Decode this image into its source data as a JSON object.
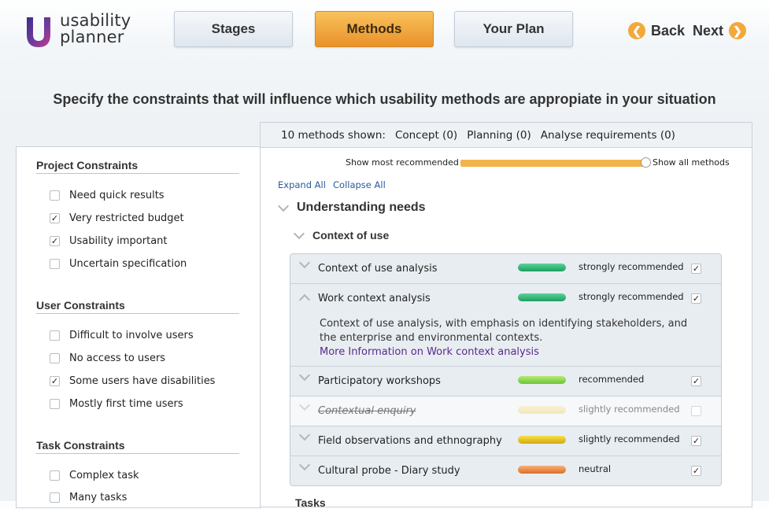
{
  "app": {
    "logo_line1": "usability",
    "logo_line2": "planner"
  },
  "nav": {
    "stages": "Stages",
    "methods": "Methods",
    "plan": "Your Plan",
    "back": "Back",
    "next": "Next",
    "active_color": "#f2a93b"
  },
  "heading": "Specify the constraints that will influence which usability methods are appropiate in your situation",
  "constraints": {
    "project": {
      "title": "Project Constraints",
      "items": [
        {
          "label": "Need quick results",
          "checked": false
        },
        {
          "label": "Very restricted budget",
          "checked": true
        },
        {
          "label": "Usability important",
          "checked": true
        },
        {
          "label": "Uncertain specification",
          "checked": false
        }
      ]
    },
    "user": {
      "title": "User Constraints",
      "items": [
        {
          "label": "Difficult to involve users",
          "checked": false
        },
        {
          "label": "No access to users",
          "checked": false
        },
        {
          "label": "Some users have disabilities",
          "checked": true
        },
        {
          "label": "Mostly first time users",
          "checked": false
        }
      ]
    },
    "task": {
      "title": "Task Constraints",
      "items": [
        {
          "label": "Complex task",
          "checked": false
        },
        {
          "label": "Many tasks",
          "checked": false
        }
      ]
    }
  },
  "summary": {
    "count": "10 methods shown:",
    "concept": "Concept (0)",
    "planning": "Planning (0)",
    "analyse": "Analyse requirements (0)"
  },
  "slider": {
    "left_label": "Show most recommended",
    "right_label": "Show all methods",
    "value": 1.0
  },
  "expand_all": "Expand All",
  "collapse_all": "Collapse All",
  "section": "Understanding needs",
  "subsection": "Context of use",
  "next_subsection": "Tasks",
  "methods": [
    {
      "name": "Context of use analysis",
      "rating": "strongly recommended",
      "color": "#2bb673",
      "checked": true,
      "expanded": false,
      "faded": false
    },
    {
      "name": "Work context analysis",
      "rating": "strongly recommended",
      "color": "#2bb673",
      "checked": true,
      "expanded": true,
      "faded": false,
      "description": "Context of use analysis, with emphasis on identifying stakeholders, and the enterprise and environmental contexts.",
      "more": "More Information on Work context analysis"
    },
    {
      "name": "Participatory workshops",
      "rating": "recommended",
      "color": "#8fd14f",
      "checked": true,
      "expanded": false,
      "faded": false
    },
    {
      "name": "Contextual enquiry",
      "rating": "slightly recommended",
      "color": "#f0dc7a",
      "checked": false,
      "expanded": false,
      "faded": true
    },
    {
      "name": "Field observations and ethnography",
      "rating": "slightly recommended",
      "color": "#e8c21a",
      "checked": true,
      "expanded": false,
      "faded": false
    },
    {
      "name": "Cultural probe - Diary study",
      "rating": "neutral",
      "color": "#ea8c3e",
      "checked": true,
      "expanded": false,
      "faded": false
    }
  ]
}
